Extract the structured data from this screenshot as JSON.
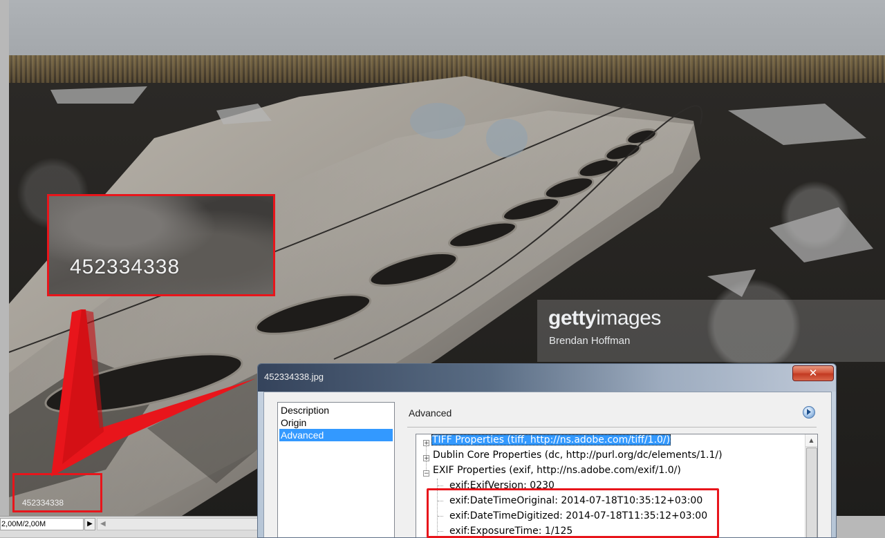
{
  "photo": {
    "watermark_logo_a": "getty",
    "watermark_logo_b": "images",
    "watermark_credit": "Brendan Hoffman",
    "zoom_text": "452334338",
    "small_text": "452334338"
  },
  "statusbar": {
    "size": "2,00M/2,00M",
    "arrow": "▶",
    "scroll_left": "◀"
  },
  "dialog": {
    "title": "452334338.jpg",
    "close_label": "✕",
    "nav": [
      {
        "label": "Description",
        "selected": false
      },
      {
        "label": "Origin",
        "selected": false
      },
      {
        "label": "Advanced",
        "selected": true
      }
    ],
    "panel_title": "Advanced",
    "tree": [
      {
        "label": "TIFF Properties (tiff, http://ns.adobe.com/tiff/1.0/)",
        "expander": "+",
        "level": 0,
        "selected": true
      },
      {
        "label": "Dublin Core Properties (dc, http://purl.org/dc/elements/1.1/)",
        "expander": "+",
        "level": 0,
        "selected": false
      },
      {
        "label": "EXIF Properties (exif, http://ns.adobe.com/exif/1.0/)",
        "expander": "−",
        "level": 0,
        "selected": false
      },
      {
        "label": "exif:ExifVersion: 0230",
        "level": 1
      },
      {
        "label": "exif:DateTimeOriginal: 2014-07-18T10:35:12+03:00",
        "level": 1
      },
      {
        "label": "exif:DateTimeDigitized: 2014-07-18T11:35:12+03:00",
        "level": 1
      },
      {
        "label": "exif:ExposureTime: 1/125",
        "level": 1
      }
    ]
  },
  "colors": {
    "annotation_red": "#e8151b",
    "selection_blue": "#3399ff"
  }
}
